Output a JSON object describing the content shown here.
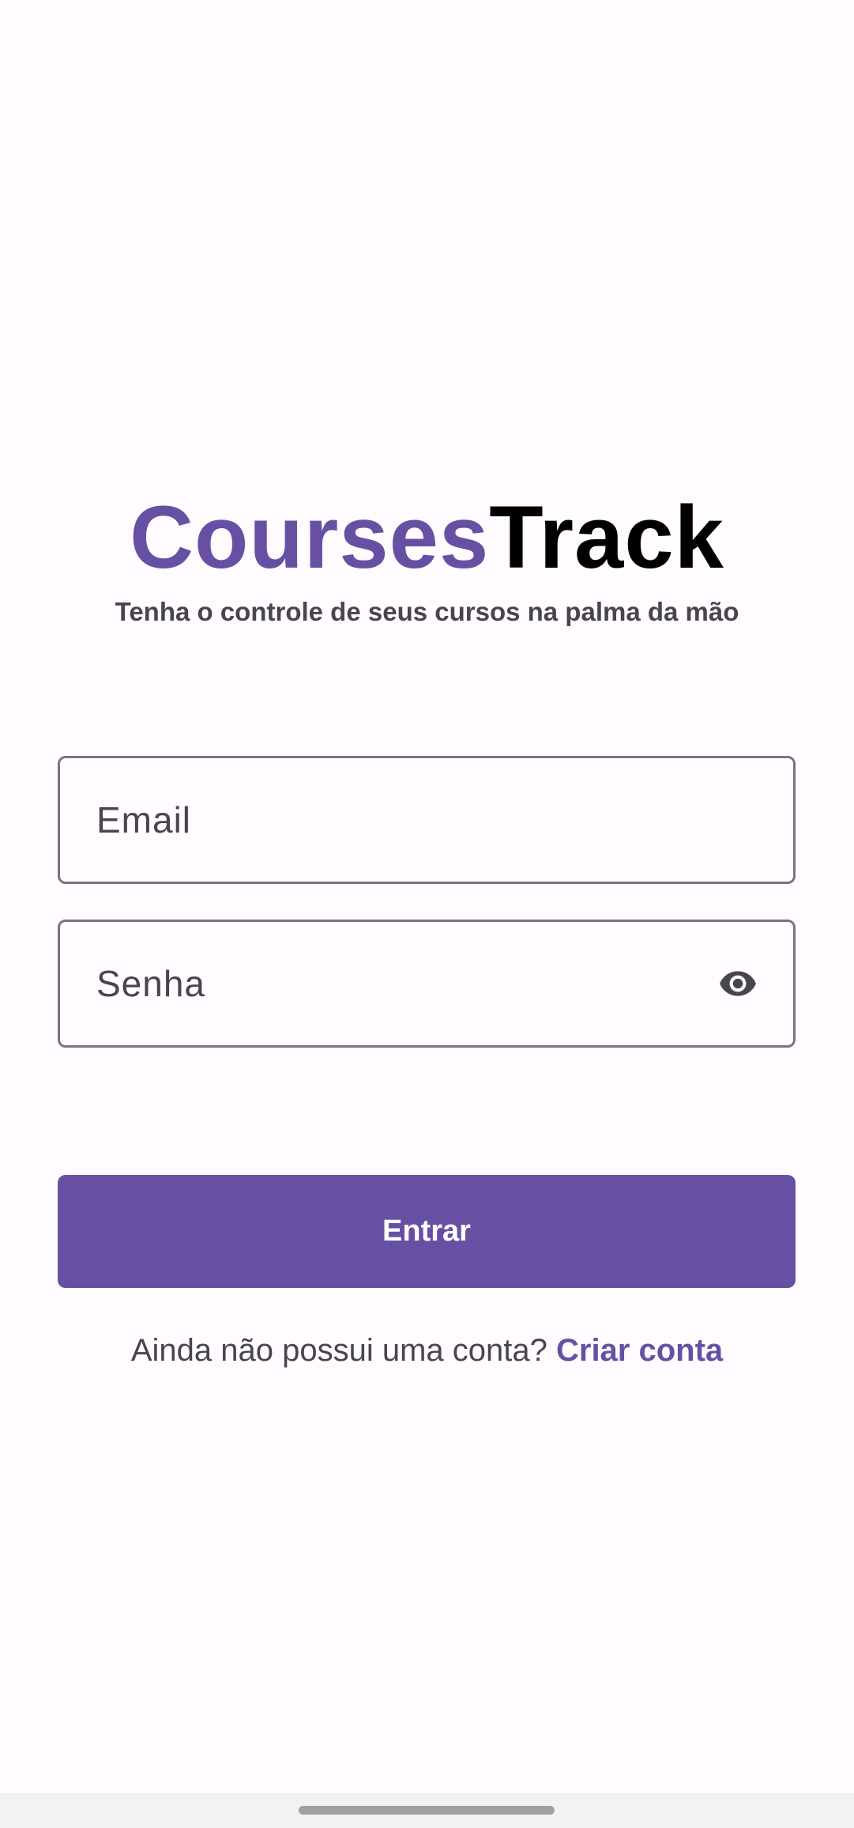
{
  "theme": {
    "accent": "#6750a4",
    "text_muted": "#49454f",
    "border": "#79747e",
    "background": "#fffbfe"
  },
  "logo": {
    "part1": "Courses",
    "part2": "Track"
  },
  "tagline": "Tenha o controle de seus cursos na palma da mão",
  "form": {
    "email_placeholder": "Email",
    "password_placeholder": "Senha",
    "password_toggle_icon": "eye-icon",
    "submit_label": "Entrar"
  },
  "signup": {
    "prompt": "Ainda não possui uma conta?",
    "link_label": "Criar conta"
  },
  "system": {
    "nav_handle_icon": "gesture-handle"
  }
}
